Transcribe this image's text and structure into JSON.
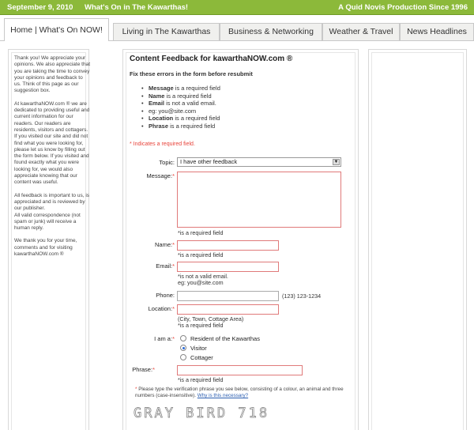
{
  "topbar": {
    "date": "September 9, 2010",
    "whats_on": "What's On in The Kawarthas!",
    "production": "A Quid Novis Production Since 1996",
    "color": "#8cb93a"
  },
  "tabs": [
    {
      "label": "Home | What's On NOW!",
      "active": true
    },
    {
      "label": "Living in The Kawarthas"
    },
    {
      "label": "Business & Networking"
    },
    {
      "label": "Weather & Travel"
    },
    {
      "label": "News Headlines"
    }
  ],
  "sidebar": {
    "paragraphs": [
      "Thank you! We appreciate your opinions. We also appreciate that you are taking the time to convey your opinions and feedback to us. Think of this page as our suggestion box.",
      "At kawarthaNOW.com ® we are dedicated to providing useful and current information for our readers. Our readers are residents, visitors and cottagers. If you visited our site and did not find what you were looking for, please let us know by filling out the form below. If you visited and found exactly what you were looking for, we would also appreciate knowing that our content was useful.",
      "All feedback is important to us, is appreciated and is reviewed by our publisher.",
      "All valid correspondence (not spam or junk) will receive a human reply.",
      "We thank you for your time, comments and for visiting kawarthaNOW.com ®"
    ]
  },
  "form": {
    "title": "Content Feedback for kawarthaNOW.com ®",
    "error_heading": "Fix these errors in the form before resubmit",
    "errors": [
      {
        "field": "Message",
        "text": " is a required field"
      },
      {
        "field": "Name",
        "text": " is a required field"
      },
      {
        "field": "Email",
        "text": " is not a valid email.",
        "hint": "eg: you@site.com"
      },
      {
        "field": "Location",
        "text": " is a required field"
      },
      {
        "field": "Phrase",
        "text": " is a required field"
      }
    ],
    "required_note": "* Indicates a required field.",
    "topic_label": "Topic:",
    "topic_value": "I have other feedback",
    "message_label": "Message:",
    "message_error": "*is a required field",
    "name_label": "Name:",
    "name_error": "*is a required field",
    "email_label": "Email:",
    "email_error": "*is not a valid email.",
    "email_hint": "eg: you@site.com",
    "phone_label": "Phone:",
    "phone_hint": "(123) 123-1234",
    "location_label": "Location:",
    "location_hint": "(City, Town, Cottage Area)",
    "location_error": "*is a required field",
    "iama_label": "I am a:",
    "iama_options": [
      "Resident of the Kawarthas",
      "Visitor",
      "Cottager"
    ],
    "iama_selected": "Visitor",
    "phrase_label": "Phrase:",
    "phrase_error": "*is a required field",
    "verify_text": "Please type the verification phrase you see below, consisting of a colour, an animal and three numbers (case-insensitive).",
    "verify_link": "Why is this necessary?",
    "captcha": "GRAY BIRD 718"
  }
}
